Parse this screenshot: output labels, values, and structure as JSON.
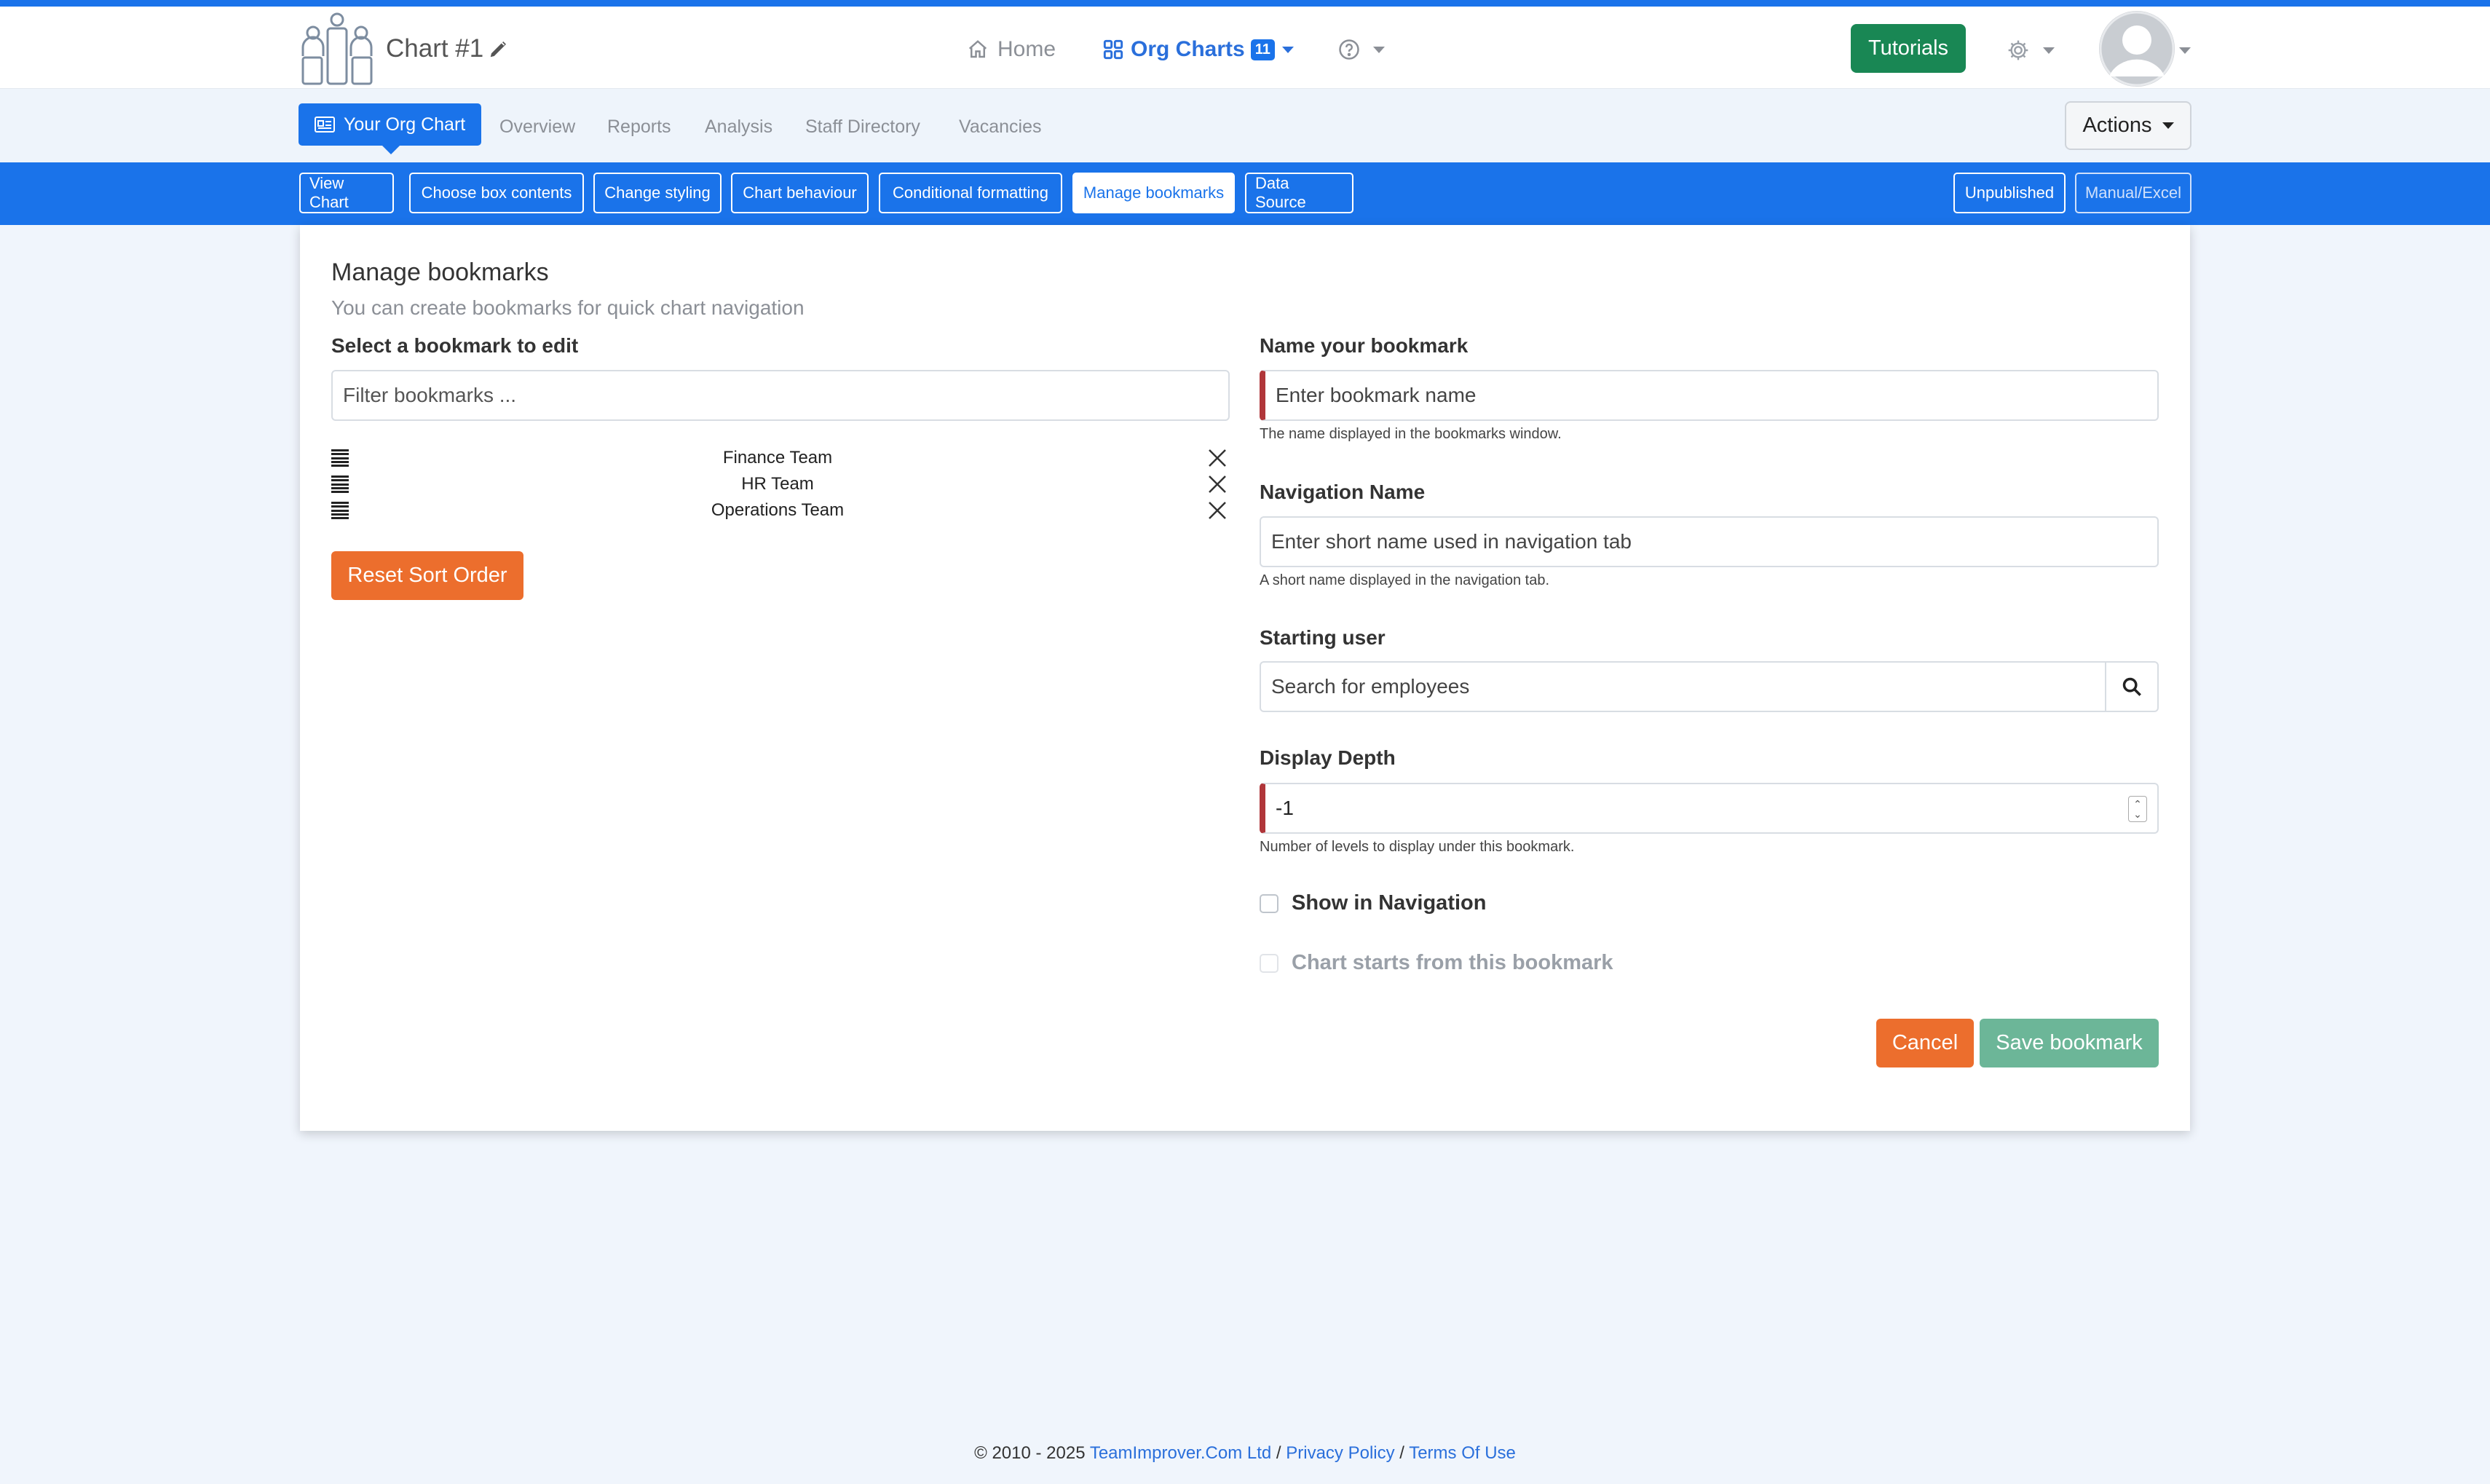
{
  "header": {
    "chart_title": "Chart #1",
    "nav": {
      "home": "Home",
      "org_charts": "Org Charts",
      "org_charts_count": "11"
    },
    "tutorials": "Tutorials"
  },
  "subnav": {
    "tabs": [
      {
        "label": "Your Org Chart",
        "active": true
      },
      {
        "label": "Overview"
      },
      {
        "label": "Reports"
      },
      {
        "label": "Analysis"
      },
      {
        "label": "Staff Directory"
      },
      {
        "label": "Vacancies"
      }
    ],
    "actions": "Actions"
  },
  "toolbar": {
    "buttons": [
      {
        "label": "View Chart"
      },
      {
        "label": "Choose box contents"
      },
      {
        "label": "Change styling"
      },
      {
        "label": "Chart behaviour"
      },
      {
        "label": "Conditional formatting"
      },
      {
        "label": "Manage bookmarks",
        "active": true
      },
      {
        "label": "Data Source"
      }
    ],
    "right": [
      {
        "label": "Unpublished"
      },
      {
        "label": "Manual/Excel"
      }
    ]
  },
  "page": {
    "title": "Manage bookmarks",
    "subtitle": "You can create bookmarks for quick chart navigation",
    "left": {
      "select_label": "Select a bookmark to edit",
      "filter_placeholder": "Filter bookmarks ...",
      "bookmarks": [
        "Finance Team",
        "HR Team",
        "Operations Team"
      ],
      "reset_button": "Reset Sort Order"
    },
    "form": {
      "name_label": "Name your bookmark",
      "name_placeholder": "Enter bookmark name",
      "name_help": "The name displayed in the bookmarks window.",
      "nav_label": "Navigation Name",
      "nav_placeholder": "Enter short name used in navigation tab",
      "nav_help": "A short name displayed in the navigation tab.",
      "start_label": "Starting user",
      "start_placeholder": "Search for employees",
      "depth_label": "Display Depth",
      "depth_value": "-1",
      "depth_help": "Number of levels to display under this bookmark.",
      "show_nav": "Show in Navigation",
      "chart_starts": "Chart starts from this bookmark",
      "cancel": "Cancel",
      "save": "Save bookmark"
    }
  },
  "footer": {
    "copyright": "© 2010 - 2025",
    "company": "TeamImprover.Com Ltd",
    "sep": "/",
    "privacy": "Privacy Policy",
    "terms": "Terms Of Use"
  },
  "colors": {
    "primary": "#1a73ea",
    "success": "#198754",
    "orange": "#ec6e2d",
    "save_disabled": "#6cb698",
    "required": "#b0363a"
  }
}
